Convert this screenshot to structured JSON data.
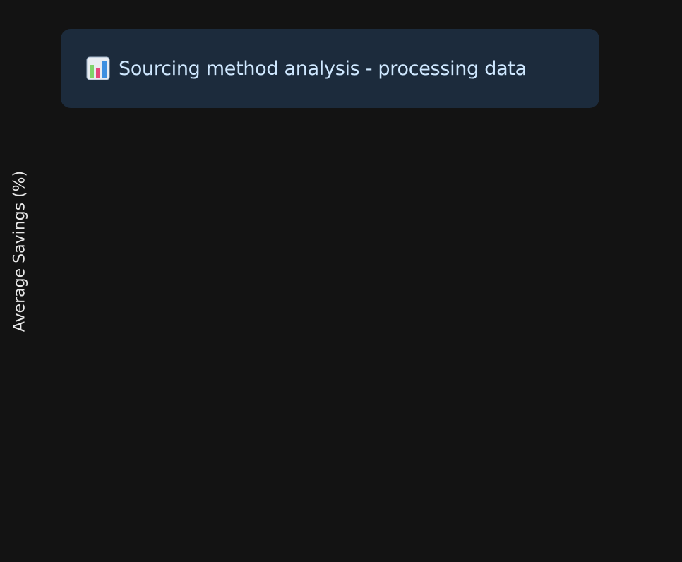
{
  "status_box": {
    "icon": "bar-chart-icon",
    "message": "Sourcing method analysis - processing data",
    "background_color": "#1c2b3c",
    "text_color": "#cfe8ff"
  },
  "chart": {
    "ylabel": "Average Savings (%)"
  },
  "chart_data": {
    "type": "bar",
    "title": "",
    "xlabel": "",
    "ylabel": "Average Savings (%)",
    "categories": [],
    "values": []
  }
}
